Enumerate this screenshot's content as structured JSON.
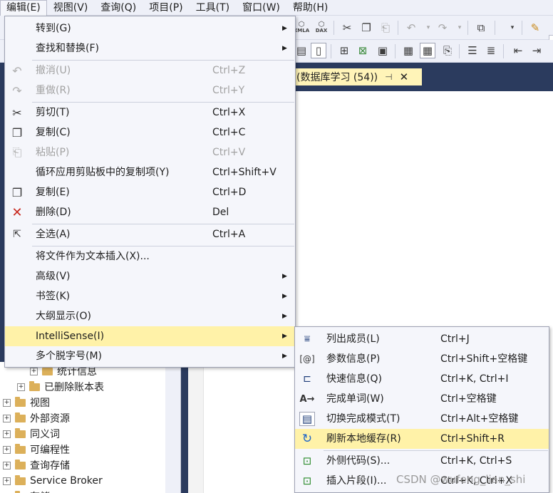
{
  "menubar": {
    "items": [
      {
        "label": "编辑(E)",
        "active": true
      },
      {
        "label": "视图(V)"
      },
      {
        "label": "查询(Q)"
      },
      {
        "label": "项目(P)"
      },
      {
        "label": "工具(T)"
      },
      {
        "label": "窗口(W)"
      },
      {
        "label": "帮助(H)"
      }
    ]
  },
  "toolbar": {
    "icons": [
      "xmla-icon",
      "dax-icon",
      "cut-icon",
      "copy-icon",
      "paste-icon",
      "undo-icon",
      "redo-icon",
      "screenshot-icon",
      "dropdown-icon",
      "highlight-icon"
    ],
    "xmla_label": "XMLA",
    "dax_label": "DAX"
  },
  "document": {
    "tab_title": "(数据库学习 (54))",
    "pin_glyph": "⊣",
    "close_glyph": "✕"
  },
  "tree": {
    "items": [
      {
        "label": "统计信息",
        "indent": 2
      },
      {
        "label": "已删除账本表",
        "indent": 1
      },
      {
        "label": "视图",
        "indent": 0
      },
      {
        "label": "外部资源",
        "indent": 0
      },
      {
        "label": "同义词",
        "indent": 0
      },
      {
        "label": "可编程性",
        "indent": 0
      },
      {
        "label": "查询存储",
        "indent": 0
      },
      {
        "label": "Service Broker",
        "indent": 0
      },
      {
        "label": "存储",
        "indent": 0
      }
    ]
  },
  "edit_menu": {
    "items": [
      {
        "label": "转到(G)",
        "shortcut": "",
        "submenu": true,
        "icon": "",
        "disabled": false
      },
      {
        "label": "查找和替换(F)",
        "shortcut": "",
        "submenu": true,
        "icon": "",
        "disabled": false
      },
      {
        "label": "撤消(U)",
        "shortcut": "Ctrl+Z",
        "submenu": false,
        "icon": "undo-icon",
        "disabled": true
      },
      {
        "label": "重做(R)",
        "shortcut": "Ctrl+Y",
        "submenu": false,
        "icon": "redo-icon",
        "disabled": true
      },
      {
        "label": "剪切(T)",
        "shortcut": "Ctrl+X",
        "submenu": false,
        "icon": "cut-icon",
        "disabled": false
      },
      {
        "label": "复制(C)",
        "shortcut": "Ctrl+C",
        "submenu": false,
        "icon": "copy-icon",
        "disabled": false
      },
      {
        "label": "粘贴(P)",
        "shortcut": "Ctrl+V",
        "submenu": false,
        "icon": "paste-icon",
        "disabled": true
      },
      {
        "label": "循环应用剪贴板中的复制项(Y)",
        "shortcut": "Ctrl+Shift+V",
        "submenu": false,
        "icon": "",
        "disabled": false
      },
      {
        "label": "复制(E)",
        "shortcut": "Ctrl+D",
        "submenu": false,
        "icon": "duplicate-icon",
        "disabled": false
      },
      {
        "label": "删除(D)",
        "shortcut": "Del",
        "submenu": false,
        "icon": "delete-icon",
        "disabled": false
      },
      {
        "label": "全选(A)",
        "shortcut": "Ctrl+A",
        "submenu": false,
        "icon": "select-all-icon",
        "disabled": false
      },
      {
        "label": "将文件作为文本插入(X)...",
        "shortcut": "",
        "submenu": false,
        "icon": "",
        "disabled": false
      },
      {
        "label": "高级(V)",
        "shortcut": "",
        "submenu": true,
        "icon": "",
        "disabled": false
      },
      {
        "label": "书签(K)",
        "shortcut": "",
        "submenu": true,
        "icon": "",
        "disabled": false
      },
      {
        "label": "大纲显示(O)",
        "shortcut": "",
        "submenu": true,
        "icon": "",
        "disabled": false
      },
      {
        "label": "IntelliSense(I)",
        "shortcut": "",
        "submenu": true,
        "icon": "",
        "disabled": false,
        "highlighted": true
      },
      {
        "label": "多个脱字号(M)",
        "shortcut": "",
        "submenu": true,
        "icon": "",
        "disabled": false
      }
    ],
    "arrow_glyph": "▶"
  },
  "intellisense_menu": {
    "items": [
      {
        "label": "列出成员(L)",
        "shortcut": "Ctrl+J",
        "icon": "list-members-icon"
      },
      {
        "label": "参数信息(P)",
        "shortcut": "Ctrl+Shift+空格键",
        "icon": "parameter-info-icon"
      },
      {
        "label": "快速信息(Q)",
        "shortcut": "Ctrl+K, Ctrl+I",
        "icon": "quick-info-icon"
      },
      {
        "label": "完成单词(W)",
        "shortcut": "Ctrl+空格键",
        "icon": "complete-word-icon"
      },
      {
        "label": "切换完成模式(T)",
        "shortcut": "Ctrl+Alt+空格键",
        "icon": "toggle-completion-icon"
      },
      {
        "label": "刷新本地缓存(R)",
        "shortcut": "Ctrl+Shift+R",
        "icon": "refresh-icon",
        "highlighted": true
      },
      {
        "label": "外侧代码(S)...",
        "shortcut": "Ctrl+K, Ctrl+S",
        "icon": "surround-with-icon"
      },
      {
        "label": "插入片段(I)...",
        "shortcut": "Ctrl+K, Ctrl+X",
        "icon": "insert-snippet-icon"
      }
    ]
  },
  "watermark": "CSDN @wufeng_lian_shi",
  "colors": {
    "menu_bg": "#f5f6fb",
    "highlight": "#fff2a8",
    "tab_bg": "#fff4b8",
    "navy": "#2b3b5e",
    "delete_red": "#c8281e",
    "refresh_blue": "#1e64c8"
  }
}
